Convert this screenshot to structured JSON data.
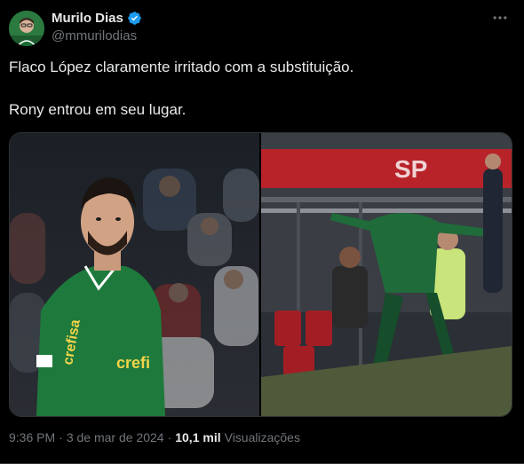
{
  "author": {
    "name": "Murilo Dias",
    "handle": "@mmurilodias",
    "avatar_icon": "person-avatar-icon",
    "verified_icon": "verified-badge-icon"
  },
  "tweet": {
    "line1": "Flaco López claramente irritado com a substituição.",
    "line2": "Rony entrou em seu lugar."
  },
  "media": [
    {
      "kind": "photo",
      "description_icon": "player-photo"
    },
    {
      "kind": "photo",
      "description_icon": "substitution-photo"
    }
  ],
  "meta": {
    "time": "9:36 PM",
    "separator": "·",
    "date": "3 de mar de 2024",
    "views_count": "10,1 mil",
    "views_label": "Visualizações"
  },
  "colors": {
    "background": "#000000",
    "text": "#e7e9ea",
    "muted": "#71767b",
    "verified": "#1d9bf0",
    "border": "#2f3336"
  }
}
